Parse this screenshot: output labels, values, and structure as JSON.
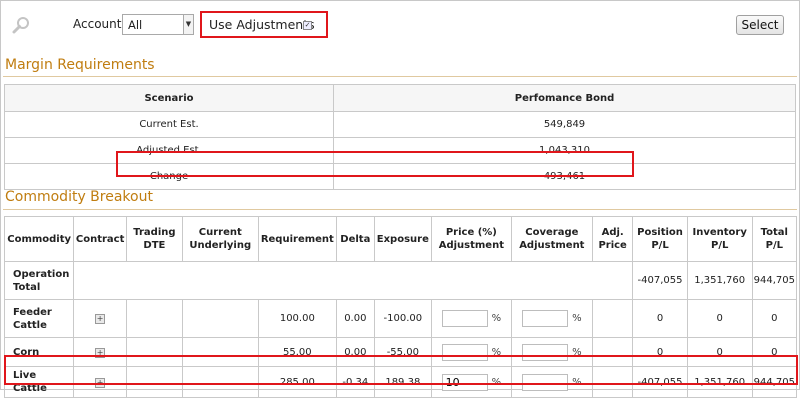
{
  "toolbar": {
    "account_label": "Account:",
    "account_value": "All",
    "use_adjustments_label": "Use Adjustments",
    "use_adjustments_checked": true,
    "select_button": "Select"
  },
  "margin": {
    "title": "Margin Requirements",
    "headers": [
      "Scenario",
      "Perfomance Bond"
    ],
    "rows": [
      {
        "scenario": "Current Est.",
        "bond": "549,849"
      },
      {
        "scenario": "Adjusted Est.",
        "bond": "1,043,310"
      },
      {
        "scenario": "Change",
        "bond": "493,461"
      }
    ]
  },
  "commodity": {
    "title": "Commodity Breakout",
    "headers": [
      "Commodity",
      "Contract",
      "Trading DTE",
      "Current Underlying",
      "Requirement",
      "Delta",
      "Exposure",
      "Price (%) Adjustment",
      "Coverage Adjustment",
      "Adj. Price",
      "Position P/L",
      "Inventory P/L",
      "Total P/L"
    ],
    "percent_sign": "%",
    "rows": [
      {
        "name": "Operation Total",
        "requirement": "",
        "delta": "",
        "exposure": "",
        "price_adj": "",
        "coverage_adj": "",
        "adj_price": "",
        "position_pl": "-407,055",
        "inventory_pl": "1,351,760",
        "total_pl": "944,705"
      },
      {
        "name": "Feeder Cattle",
        "requirement": "100.00",
        "delta": "0.00",
        "exposure": "-100.00",
        "price_adj": "",
        "coverage_adj": "",
        "adj_price": "",
        "position_pl": "0",
        "inventory_pl": "0",
        "total_pl": "0"
      },
      {
        "name": "Corn",
        "requirement": "55.00",
        "delta": "0.00",
        "exposure": "-55.00",
        "price_adj": "",
        "coverage_adj": "",
        "adj_price": "",
        "position_pl": "0",
        "inventory_pl": "0",
        "total_pl": "0"
      },
      {
        "name": "Live Cattle",
        "requirement": "285.00",
        "delta": "-0.34",
        "exposure": "189.38",
        "price_adj": "10",
        "coverage_adj": "",
        "adj_price": "",
        "position_pl": "-407,055",
        "inventory_pl": "1,351,760",
        "total_pl": "944,705"
      }
    ]
  },
  "colors": {
    "accent_title": "#c07d10",
    "highlight_box": "#e0161b"
  }
}
